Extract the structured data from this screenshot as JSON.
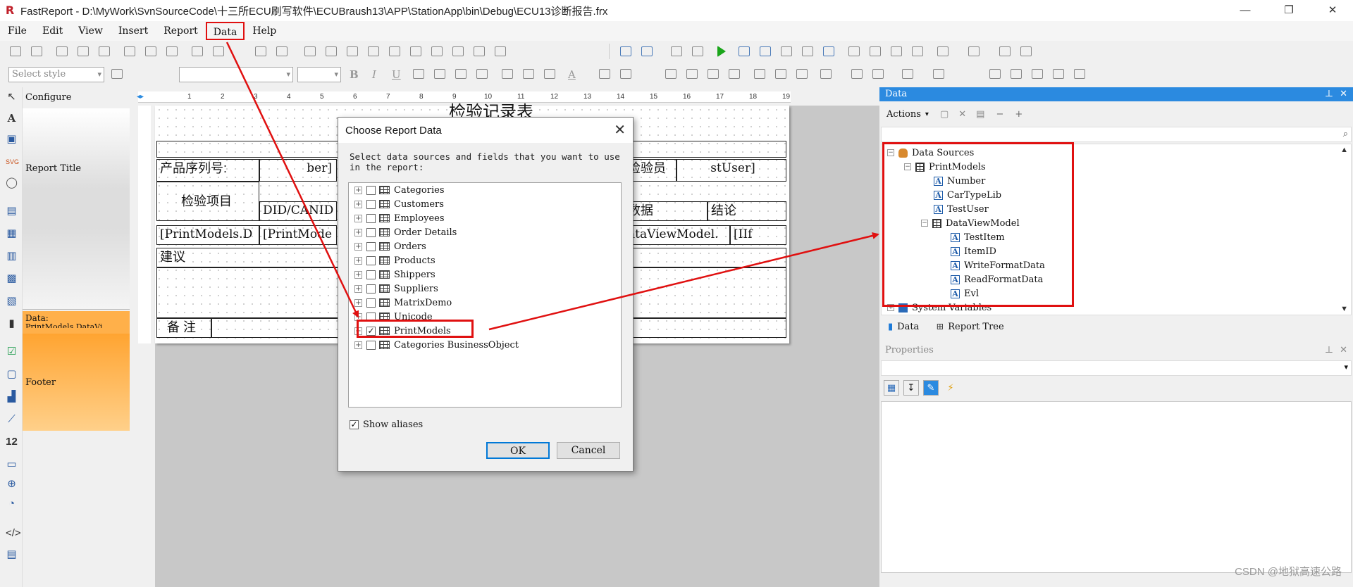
{
  "window": {
    "title": "FastReport - D:\\MyWork\\SvnSourceCode\\十三所ECU刷写软件\\ECUBraush13\\APP\\StationApp\\bin\\Debug\\ECU13诊断报告.frx",
    "logo": "R"
  },
  "menu": {
    "items": [
      "File",
      "Edit",
      "View",
      "Insert",
      "Report",
      "Data",
      "Help"
    ]
  },
  "toolbar": {
    "style_combo": "Select style"
  },
  "bands": {
    "configure": "Configure",
    "report_title": "Report Title",
    "data": "Data:",
    "data_sub": "PrintModels.DataVi",
    "footer": "Footer"
  },
  "ruler": {
    "ticks": [
      "1",
      "2",
      "3",
      "4",
      "5",
      "6",
      "7",
      "8",
      "9",
      "10",
      "11",
      "12",
      "13",
      "14",
      "15",
      "16",
      "17",
      "18",
      "19"
    ]
  },
  "report": {
    "title": "检验记录表",
    "product_serial_label": "产品序列号:",
    "serial_value": "ber]",
    "inspector_label": "检验员",
    "inspector_value": "stUser]",
    "item_label": "检验项目",
    "did_label": "DID/CANID",
    "data_label": "数据",
    "result_label": "结论",
    "row_cell1": "[PrintModels.D",
    "row_cell2": "[PrintMode",
    "row_cell3": "ataViewModel.",
    "row_cell4": "[IIf",
    "advice_label": "建议",
    "remark_label": "备 注"
  },
  "dialog": {
    "title": "Choose Report Data",
    "description": "Select data sources and fields that you want to use in the report:",
    "sources": [
      {
        "name": "Categories",
        "checked": false
      },
      {
        "name": "Customers",
        "checked": false
      },
      {
        "name": "Employees",
        "checked": false
      },
      {
        "name": "Order Details",
        "checked": false
      },
      {
        "name": "Orders",
        "checked": false
      },
      {
        "name": "Products",
        "checked": false
      },
      {
        "name": "Shippers",
        "checked": false
      },
      {
        "name": "Suppliers",
        "checked": false
      },
      {
        "name": "MatrixDemo",
        "checked": false
      },
      {
        "name": "Unicode",
        "checked": false
      },
      {
        "name": "PrintModels",
        "checked": true
      },
      {
        "name": "Categories BusinessObject",
        "checked": false
      }
    ],
    "show_aliases": "Show aliases",
    "ok": "OK",
    "cancel": "Cancel"
  },
  "data_panel": {
    "header": "Data",
    "actions": "Actions",
    "tree": {
      "root": "Data Sources",
      "table": "PrintModels",
      "fields": [
        "Number",
        "CarTypeLib",
        "TestUser"
      ],
      "sub_table": "DataViewModel",
      "sub_fields": [
        "TestItem",
        "ItemID",
        "WriteFormatData",
        "ReadFormatData",
        "Evl"
      ],
      "system_variables": "System Variables"
    },
    "tabs": [
      "Data",
      "Report Tree"
    ]
  },
  "properties": {
    "header": "Properties"
  },
  "watermark": "CSDN @地狱高速公路",
  "colors": {
    "highlight_red": "#e01010",
    "panel_blue": "#2b8ae0",
    "band_orange": "#ffb04a"
  }
}
